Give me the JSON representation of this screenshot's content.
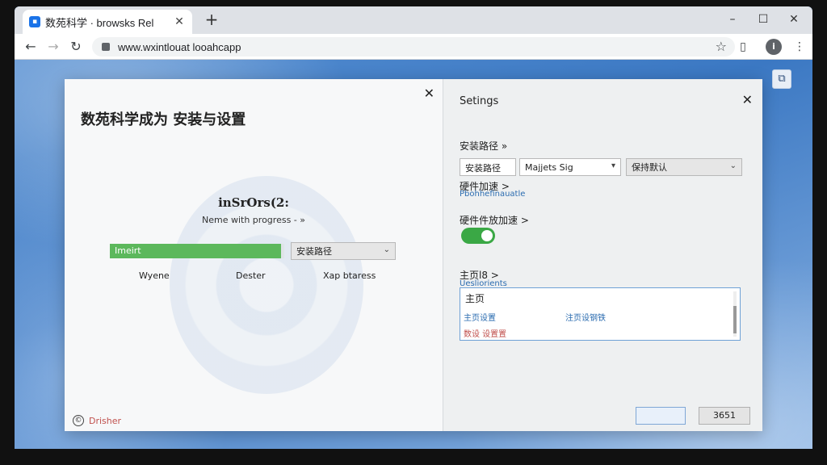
{
  "browser": {
    "tab_title": "数苑科学 · browsks Rel",
    "tab_favicon": "app-icon",
    "url": "www.wxintlouat looahcapp",
    "new_tab_label": "+",
    "profile_label": "i"
  },
  "dialog_left": {
    "title": "数苑科学成为  安装与设置",
    "section_title": "inSrOrs(2:",
    "section_subtitle": "Neme with progress -  »",
    "progress_label": "Imeirt",
    "progress_fraction": 0.98,
    "select_value": "安装路径",
    "status_labels": [
      "Wyene",
      "Dester",
      "Xap btaress"
    ],
    "footer_link": "Drisher"
  },
  "dialog_right": {
    "title": "Setings",
    "install_path_label": "安装路径 »",
    "install_path_input": "安装路径",
    "select_middle": "Majjets Sig",
    "select_right": "保持默认",
    "hw_accel_label": "硬件加速 >",
    "hw_accel_sub": "Pbohhefinauatle",
    "hw_toggle_label": "硬件件放加速 >",
    "hw_toggle_on": true,
    "homepage_label": "主页l8 >",
    "homepage_sub": "Uesliorients",
    "list_header": "主页",
    "list_items": [
      "主页设置",
      "注页设钢铁",
      "数设 设置置"
    ],
    "ok_label": "",
    "cancel_label": "3651"
  },
  "colors": {
    "accent_blue": "#2f6fb8",
    "progress_green": "#5cb85c",
    "toggle_green": "#3aa845",
    "link_red": "#c0504d"
  }
}
